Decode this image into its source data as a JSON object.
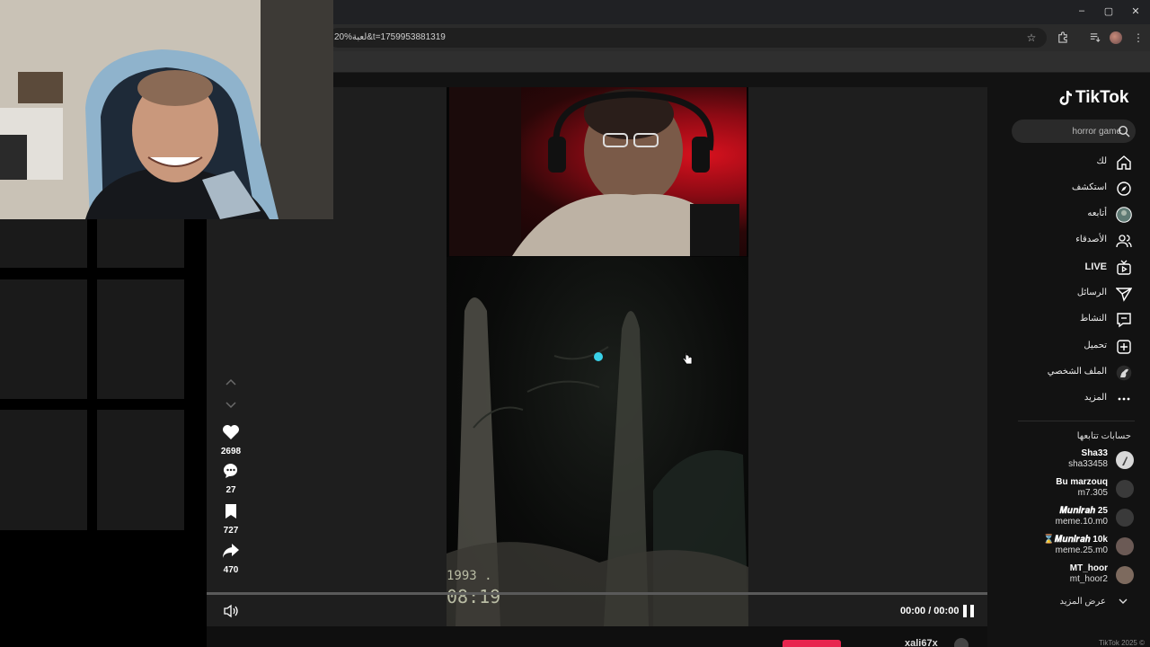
{
  "browser": {
    "url_text": "20%لعبة&t=1759953881319",
    "window_controls": {
      "minimize": "–",
      "restore": "▢",
      "close": "✕"
    },
    "icons": [
      "bookmark-star-icon",
      "extensions-icon",
      "media-queue-icon",
      "profile-avatar-icon",
      "menu-kebab-icon"
    ]
  },
  "video": {
    "vhs_date": "1993 .",
    "vhs_time": "08:19",
    "time_display": "00:00 / 00:00",
    "progress": 0.0
  },
  "actions": {
    "likes": "2698",
    "comments": "27",
    "saves": "727",
    "shares": "470"
  },
  "sidebar": {
    "logo_text": "TikTok",
    "search": {
      "value": "",
      "placeholder": "horror game"
    },
    "nav": [
      {
        "label": "لك",
        "icon": "home-icon"
      },
      {
        "label": "استكشف",
        "icon": "compass-icon"
      },
      {
        "label": "أتابعه",
        "icon": "following-avatar-icon"
      },
      {
        "label": "الأصدقاء",
        "icon": "friends-icon"
      },
      {
        "label": "LIVE",
        "icon": "live-icon"
      },
      {
        "label": "الرسائل",
        "icon": "messages-icon"
      },
      {
        "label": "النشاط",
        "icon": "activity-icon"
      },
      {
        "label": "تحميل",
        "icon": "upload-icon"
      },
      {
        "label": "الملف الشخصي",
        "icon": "profile-icon"
      },
      {
        "label": "المزيد",
        "icon": "more-icon"
      }
    ],
    "following_title": "حسابات تتابعها",
    "accounts": [
      {
        "name": "Sha33",
        "handle": "sha33458"
      },
      {
        "name": "Bu marzouq",
        "handle": "m7.305"
      },
      {
        "name": "𝑴𝒖𝒏𝒊𝒓𝒂𝒉 25",
        "handle": "meme.10.m0"
      },
      {
        "name": "⌛𝑴𝒖𝒏𝒊𝒓𝒂𝒉 10k",
        "handle": "meme.25.m0"
      },
      {
        "name": "MT_hoor",
        "handle": "mt_hoor2"
      }
    ],
    "see_more": "عرض المزيد",
    "copyright": "TikTok 2025 ©"
  },
  "bottom": {
    "username": "xali67x"
  },
  "colors": {
    "accent_red": "#e8254f",
    "background": "#121212",
    "search_bg": "#2a2a2a"
  }
}
